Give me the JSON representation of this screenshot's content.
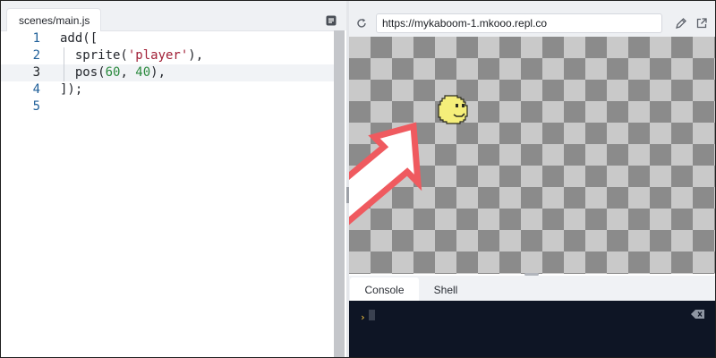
{
  "editor": {
    "tab_label": "scenes/main.js",
    "lines": [
      {
        "num": "1",
        "text": "add(["
      },
      {
        "num": "2",
        "text": "  sprite(",
        "str": "'player'",
        "tail": "),"
      },
      {
        "num": "3",
        "text": "  pos(",
        "n1": "60",
        "sep": ", ",
        "n2": "40",
        "tail": "),"
      },
      {
        "num": "4",
        "text": "]);"
      },
      {
        "num": "5",
        "text": ""
      }
    ],
    "active_line": 3
  },
  "webview": {
    "url": "https://mykaboom-1.mkooo.repl.co",
    "icons": [
      "reload-icon",
      "pencil-icon",
      "open-external-icon"
    ]
  },
  "console_panel": {
    "tabs": [
      "Console",
      "Shell"
    ],
    "active_tab": "Console",
    "prompt": "›"
  },
  "colors": {
    "arrow": "#ef5a5f",
    "player": "#f5ee7a",
    "console_bg": "#0e1525"
  }
}
